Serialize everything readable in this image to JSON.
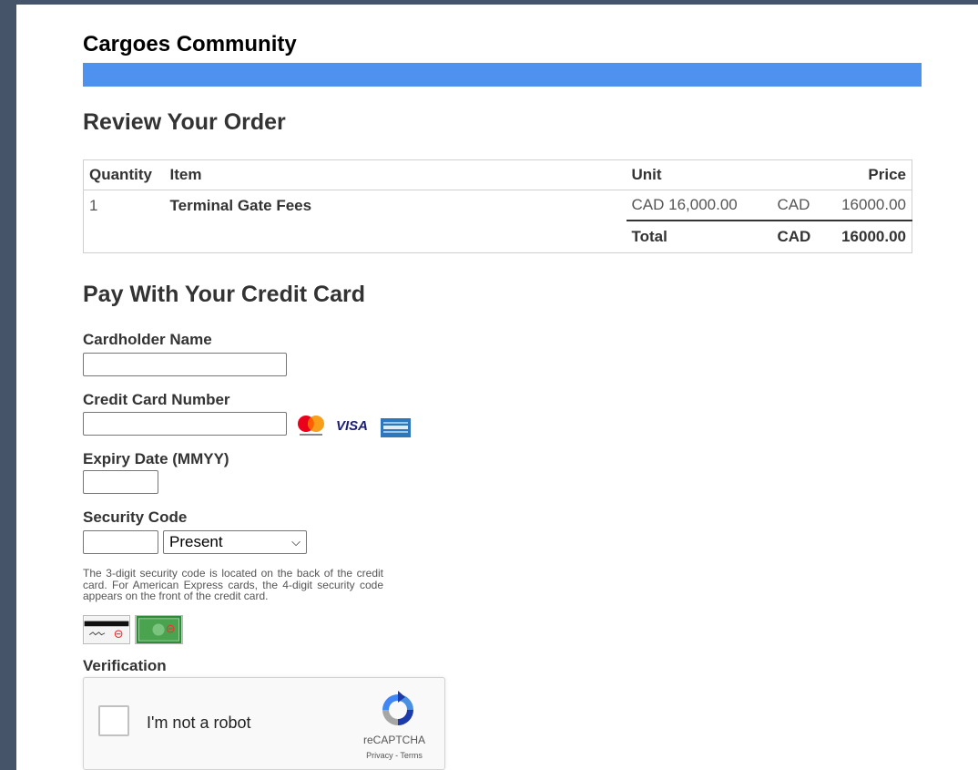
{
  "header": {
    "brand": "Cargoes Community"
  },
  "review": {
    "title": "Review Your Order",
    "columns": {
      "quantity": "Quantity",
      "item": "Item",
      "unit": "Unit",
      "price": "Price"
    },
    "row": {
      "quantity": "1",
      "item": "Terminal Gate Fees",
      "unit": "CAD 16,000.00",
      "currency": "CAD",
      "price": "16000.00"
    },
    "total": {
      "label": "Total",
      "currency": "CAD",
      "amount": "16000.00"
    }
  },
  "payment": {
    "title": "Pay With Your Credit Card",
    "cardholder_label": "Cardholder Name",
    "cardholder_value": "",
    "card_number_label": "Credit Card Number",
    "card_number_value": "",
    "card_brands": [
      "mastercard-icon",
      "visa-icon",
      "amex-icon"
    ],
    "visa_text": "VISA",
    "expiry_label": "Expiry Date (MMYY)",
    "expiry_value": "",
    "security_label": "Security Code",
    "security_value": "",
    "security_select": "Present",
    "security_help": "The 3-digit security code is located on the back of the credit card. For American Express cards, the 4-digit security code appears on the front of the credit card.",
    "verification_label": "Verification"
  },
  "recaptcha": {
    "label": "I'm not a robot",
    "brand": "reCAPTCHA",
    "links": "Privacy - Terms"
  },
  "colors": {
    "brand_bar": "#4f91ee",
    "frame": "#455468"
  }
}
